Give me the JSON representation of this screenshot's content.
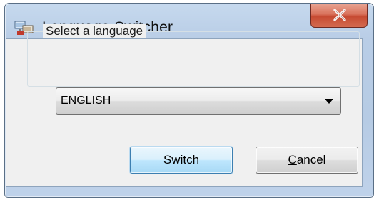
{
  "window": {
    "title": "Language Switcher",
    "app_icon": "language-switcher-app-icon",
    "close_icon": "close-icon"
  },
  "group": {
    "label": "Select a language"
  },
  "language_select": {
    "selected": "ENGLISH",
    "arrow_icon": "dropdown-arrow-icon"
  },
  "buttons": {
    "switch_label": "Switch",
    "cancel_label": "Cancel"
  },
  "colors": {
    "title_bar": "#b9cde6",
    "close_button": "#c64a32",
    "default_button_border": "#3c7fb1",
    "dialog_background": "#f0f0f0"
  }
}
